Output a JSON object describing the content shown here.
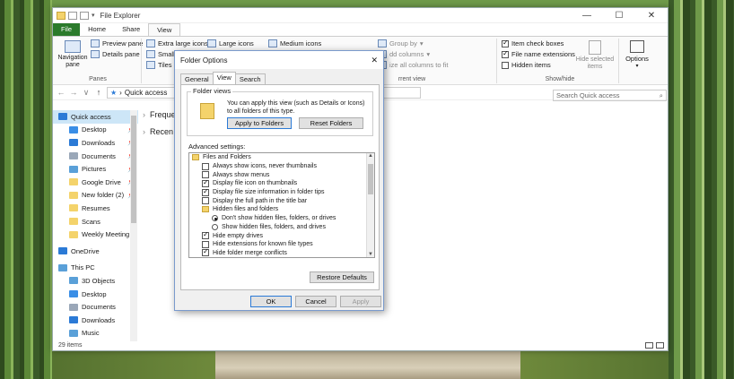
{
  "explorer": {
    "title": "File Explorer",
    "window_controls": [
      "—",
      "☐",
      "✕"
    ],
    "tabs": [
      "File",
      "Home",
      "Share",
      "View"
    ],
    "ribbon": {
      "panes": {
        "navigation_pane": "Navigation pane",
        "preview_pane": "Preview pane",
        "details_pane": "Details pane",
        "label": "Panes"
      },
      "layout": {
        "items": [
          "Extra large icons",
          "Large icons",
          "Medium icons",
          "Small",
          "Tiles"
        ]
      },
      "current_view": {
        "group_by": "Group by",
        "add_columns": "dd columns",
        "size_columns": "ize all columns to fit",
        "label": "rrent view"
      },
      "show_hide": {
        "item_checkboxes": "Item check boxes",
        "file_name_extensions": "File name extensions",
        "hidden_items": "Hidden items",
        "hide_selected": "Hide selected items",
        "label": "Show/hide"
      },
      "options": "Options"
    },
    "address": {
      "path": "Quick access"
    },
    "search_placeholder": "Search Quick access",
    "sections": [
      "Freque",
      "Recen"
    ],
    "sidebar": {
      "items": [
        {
          "label": "Quick access",
          "icon": "star-icon",
          "color": "#2b7ad6",
          "pinned": false,
          "top": true
        },
        {
          "label": "Desktop",
          "icon": "desktop-icon",
          "color": "#3a8ee6",
          "pinned": true
        },
        {
          "label": "Downloads",
          "icon": "downloads-icon",
          "color": "#2b7ad6",
          "pinned": true
        },
        {
          "label": "Documents",
          "icon": "documents-icon",
          "color": "#9aa7b8",
          "pinned": true
        },
        {
          "label": "Pictures",
          "icon": "pictures-icon",
          "color": "#5aa0d8",
          "pinned": true
        },
        {
          "label": "Google Drive",
          "icon": "google-drive-icon",
          "color": "#f4d36b",
          "pinned": true
        },
        {
          "label": "New folder (2)",
          "icon": "folder-icon",
          "color": "#f4d36b",
          "pinned": true
        },
        {
          "label": "Resumes",
          "icon": "folder-icon",
          "color": "#f4d36b",
          "pinned": false
        },
        {
          "label": "Scans",
          "icon": "folder-icon",
          "color": "#f4d36b",
          "pinned": false
        },
        {
          "label": "Weekly Meeting",
          "icon": "folder-icon",
          "color": "#f4d36b",
          "pinned": false
        },
        {
          "label": "OneDrive",
          "icon": "onedrive-icon",
          "color": "#2b7ad6",
          "pinned": false,
          "top": true
        },
        {
          "label": "This PC",
          "icon": "pc-icon",
          "color": "#5aa0d8",
          "pinned": false,
          "top": true
        },
        {
          "label": "3D Objects",
          "icon": "objects-icon",
          "color": "#5aa0d8",
          "pinned": false
        },
        {
          "label": "Desktop",
          "icon": "desktop-icon",
          "color": "#3a8ee6",
          "pinned": false
        },
        {
          "label": "Documents",
          "icon": "documents-icon",
          "color": "#9aa7b8",
          "pinned": false
        },
        {
          "label": "Downloads",
          "icon": "downloads-icon",
          "color": "#2b7ad6",
          "pinned": false
        },
        {
          "label": "Music",
          "icon": "music-icon",
          "color": "#5aa0d8",
          "pinned": false
        }
      ]
    },
    "status": "29 items"
  },
  "dialog": {
    "title": "Folder Options",
    "close": "✕",
    "tabs": [
      "General",
      "View",
      "Search"
    ],
    "folder_views": {
      "legend": "Folder views",
      "text": "You can apply this view (such as Details or Icons) to all folders of this type.",
      "apply_button": "Apply to Folders",
      "reset_button": "Reset Folders"
    },
    "advanced_label": "Advanced settings:",
    "settings": [
      {
        "level": 0,
        "type": "folder",
        "label": "Files and Folders"
      },
      {
        "level": 1,
        "type": "checkbox",
        "checked": false,
        "label": "Always show icons, never thumbnails"
      },
      {
        "level": 1,
        "type": "checkbox",
        "checked": false,
        "label": "Always show menus"
      },
      {
        "level": 1,
        "type": "checkbox",
        "checked": true,
        "label": "Display file icon on thumbnails"
      },
      {
        "level": 1,
        "type": "checkbox",
        "checked": true,
        "label": "Display file size information in folder tips"
      },
      {
        "level": 1,
        "type": "checkbox",
        "checked": false,
        "label": "Display the full path in the title bar"
      },
      {
        "level": 1,
        "type": "folder",
        "label": "Hidden files and folders"
      },
      {
        "level": 2,
        "type": "radio",
        "checked": true,
        "label": "Don't show hidden files, folders, or drives"
      },
      {
        "level": 2,
        "type": "radio",
        "checked": false,
        "label": "Show hidden files, folders, and drives"
      },
      {
        "level": 1,
        "type": "checkbox",
        "checked": true,
        "label": "Hide empty drives"
      },
      {
        "level": 1,
        "type": "checkbox",
        "checked": false,
        "label": "Hide extensions for known file types"
      },
      {
        "level": 1,
        "type": "checkbox",
        "checked": true,
        "label": "Hide folder merge conflicts"
      }
    ],
    "restore_defaults": "Restore Defaults",
    "ok": "OK",
    "cancel": "Cancel",
    "apply": "Apply"
  }
}
